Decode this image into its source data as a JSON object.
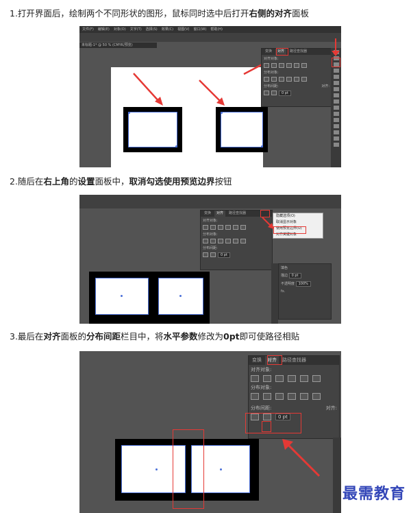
{
  "steps": [
    {
      "prefix": "1.打开界面后，绘制两个不同形状的图形，鼠标同时选中后打开",
      "bold1": "右侧的对齐",
      "suffix": "面板"
    },
    {
      "prefix": "2.随后在",
      "bold1": "右上角",
      "mid": "的",
      "bold2": "设置",
      "mid2": "面板中，",
      "bold3": "取消勾选使用预览边界",
      "suffix": "按钮"
    },
    {
      "prefix": "3.最后在",
      "bold1": "对齐",
      "mid": "面板的",
      "bold2": "分布间距",
      "mid2": "栏目中，将",
      "bold3": "水平参数",
      "mid3": "修改为",
      "bold4": "0pt",
      "suffix": "即可使路径相贴"
    }
  ],
  "shot1": {
    "menu": [
      "文件(F)",
      "编辑(E)",
      "对象(O)",
      "文字(T)",
      "选择(S)",
      "效果(C)",
      "视图(V)",
      "窗口(W)",
      "帮助(H)"
    ],
    "doc_tab": "未标题-1* @ 50 % (CMYK/预览)",
    "panel_tabs": [
      "变换",
      "对齐",
      "路径查找器"
    ],
    "labels": {
      "align_objects": "对齐对象:",
      "distribute_objects": "分布对象:",
      "distribute_spacing": "分布间距:",
      "align_to": "对齐:"
    },
    "spacing_value": "0 pt"
  },
  "shot2": {
    "panel_tabs": [
      "变换",
      "对齐",
      "路径查找器"
    ],
    "labels": {
      "align_objects": "对齐对象:",
      "distribute_objects": "分布对象:",
      "distribute_spacing": "分布间距:"
    },
    "spacing_value": "0 pt",
    "menu_items": [
      "隐藏选项(O)",
      "取消显示对象",
      "使用预览边界(U)",
      "对齐关键对象"
    ],
    "right_panel": {
      "fill": "填色",
      "stroke": "描边",
      "opacity": "不透明度",
      "opacity_value": "100%",
      "stroke_value": "0 pt",
      "fx": "fx."
    }
  },
  "shot3": {
    "panel_tabs": [
      "变换",
      "对齐",
      "路径查找器"
    ],
    "labels": {
      "align_objects": "对齐对象:",
      "distribute_objects": "分布对象:",
      "distribute_spacing": "分布间距:",
      "align_to": "对齐:"
    },
    "spacing_value": "0 pt"
  },
  "watermark": "最需教育"
}
